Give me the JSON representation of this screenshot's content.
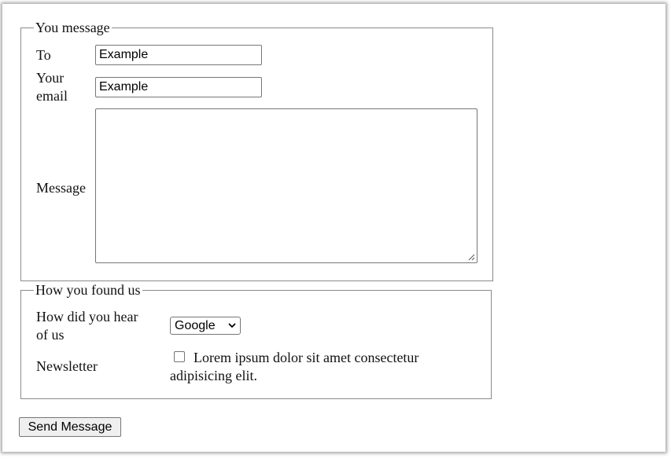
{
  "message_section": {
    "legend": "You message",
    "to_label": "To",
    "to_value": "Example",
    "email_label_line1": "Your",
    "email_label_line2": "email",
    "email_value": "Example",
    "message_label": "Message",
    "message_value": ""
  },
  "found_section": {
    "legend": "How you found us",
    "hear_label_line1": "How did you hear",
    "hear_label_line2": "of us",
    "hear_selected": "Google",
    "newsletter_label": "Newsletter",
    "newsletter_checked": false,
    "newsletter_text_line1": "Lorem ipsum dolor sit amet consectetur",
    "newsletter_text_line2": "adipisicing elit."
  },
  "send_button_label": "Send Message"
}
